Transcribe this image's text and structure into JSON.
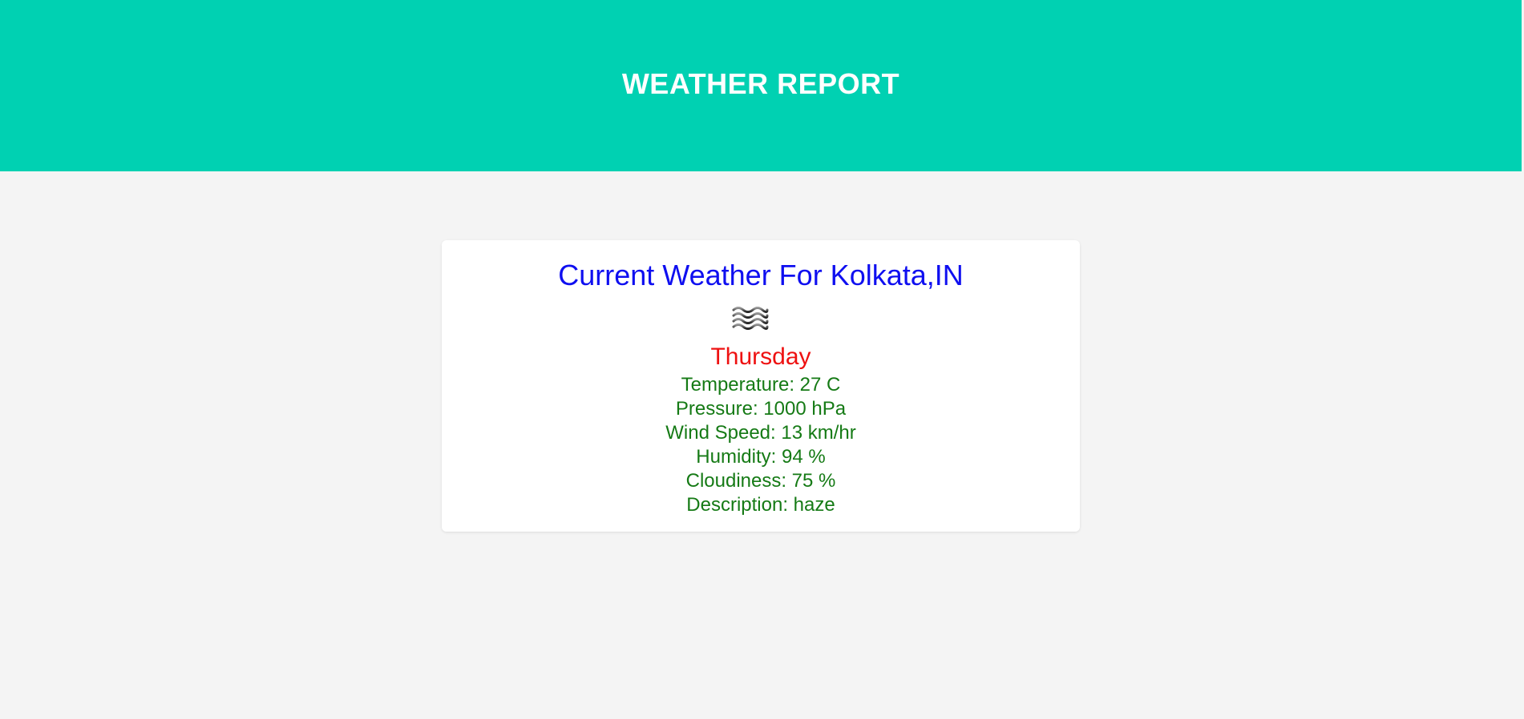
{
  "header": {
    "title": "WEATHER REPORT"
  },
  "card": {
    "title": "Current Weather For Kolkata,IN",
    "icon": "haze-icon",
    "day": "Thursday",
    "stats": [
      "Temperature: 27 C",
      "Pressure: 1000 hPa",
      "Wind Speed: 13 km/hr",
      "Humidity: 94 %",
      "Cloudiness: 75 %",
      "Description: haze"
    ]
  },
  "colors": {
    "header_bg": "#00d1b2",
    "page_bg": "#f4f4f4",
    "title": "#0f0ff0",
    "day": "#ee1111",
    "stats": "#157a15"
  }
}
